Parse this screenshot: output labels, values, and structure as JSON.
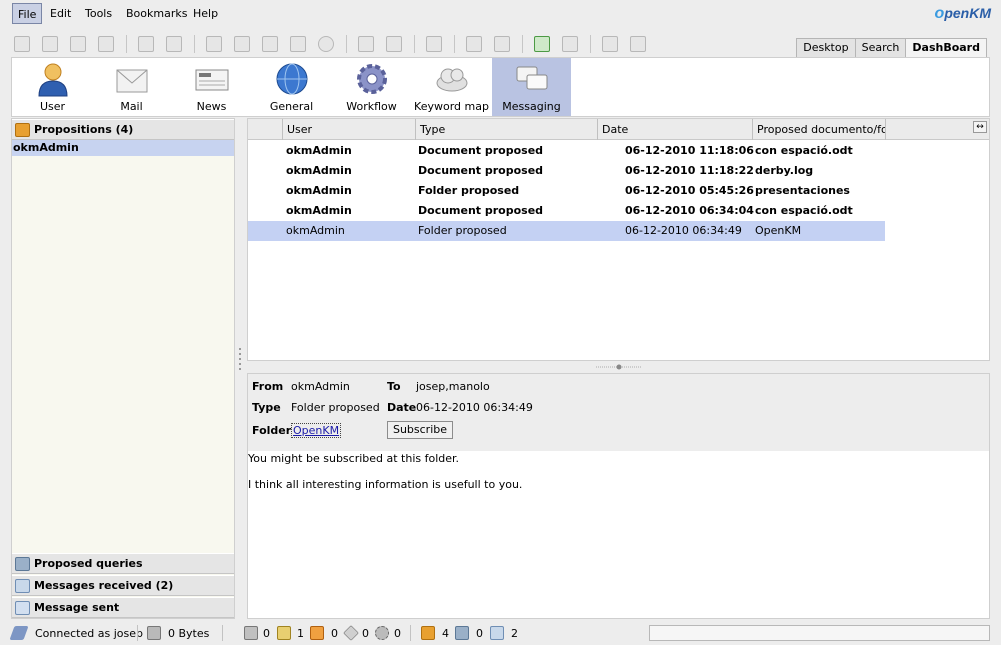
{
  "menu": [
    "File",
    "Edit",
    "Tools",
    "Bookmarks",
    "Help"
  ],
  "logo": {
    "prefix": "o",
    "name": "penKM"
  },
  "view_tabs": [
    "Desktop",
    "Search",
    "DashBoard"
  ],
  "tools": [
    "User",
    "Mail",
    "News",
    "General",
    "Workflow",
    "Keyword map",
    "Messaging"
  ],
  "left": {
    "propositions": "Propositions (4)",
    "selected_user": "okmAdmin",
    "proposed_queries": "Proposed queries",
    "messages_received": "Messages received (2)",
    "message_sent": "Message sent"
  },
  "grid": {
    "columns": [
      "User",
      "Type",
      "Date",
      "Proposed documento/folder"
    ],
    "rows": [
      {
        "user": "okmAdmin",
        "type": "Document proposed",
        "date": "06-12-2010 11:18:06",
        "target": "con espació.odt"
      },
      {
        "user": "okmAdmin",
        "type": "Document proposed",
        "date": "06-12-2010 11:18:22",
        "target": "derby.log"
      },
      {
        "user": "okmAdmin",
        "type": "Folder proposed",
        "date": "06-12-2010 05:45:26",
        "target": "presentaciones"
      },
      {
        "user": "okmAdmin",
        "type": "Document proposed",
        "date": "06-12-2010 06:34:04",
        "target": "con espació.odt"
      },
      {
        "user": "okmAdmin",
        "type": "Folder proposed",
        "date": "06-12-2010 06:34:49",
        "target": "OpenKM"
      }
    ]
  },
  "detail": {
    "from_label": "From",
    "from": "okmAdmin",
    "to_label": "To",
    "to": "josep,manolo",
    "type_label": "Type",
    "type": "Folder proposed",
    "date_label": "Date",
    "date": "06-12-2010 06:34:49",
    "folder_label": "Folder",
    "folder": "OpenKM",
    "subscribe": "Subscribe",
    "line1": "You might be subscribed at this folder.",
    "line2": "I think all interesting information is usefull to you."
  },
  "status": {
    "connected": "Connected as josep",
    "size": "0 Bytes",
    "locked": "0",
    "checkout": "1",
    "mail": "0",
    "tags": "0",
    "workflow": "0",
    "propositions": "4",
    "queries": "0",
    "messages": "2"
  }
}
